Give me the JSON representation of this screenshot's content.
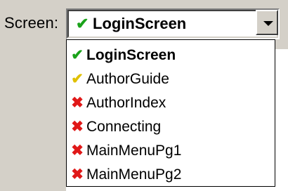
{
  "label": "Screen:",
  "combo": {
    "value": "LoginScreen",
    "value_icon": "✔",
    "value_status": "ok"
  },
  "items": [
    {
      "label": "LoginScreen",
      "status": "ok",
      "icon": "✔",
      "selected": true
    },
    {
      "label": "AuthorGuide",
      "status": "warn",
      "icon": "✔",
      "selected": false
    },
    {
      "label": "AuthorIndex",
      "status": "err",
      "icon": "✖",
      "selected": false
    },
    {
      "label": "Connecting",
      "status": "err",
      "icon": "✖",
      "selected": false
    },
    {
      "label": "MainMenuPg1",
      "status": "err",
      "icon": "✖",
      "selected": false
    },
    {
      "label": "MainMenuPg2",
      "status": "err",
      "icon": "✖",
      "selected": false
    }
  ],
  "colors": {
    "ok": "#1aa21a",
    "warn": "#e0c000",
    "err": "#e01818",
    "chrome": "#d4d0c8"
  },
  "icons": {
    "ok": "check-icon-green",
    "warn": "check-icon-yellow",
    "err": "x-icon-red",
    "dropdown": "chevron-down-icon"
  }
}
